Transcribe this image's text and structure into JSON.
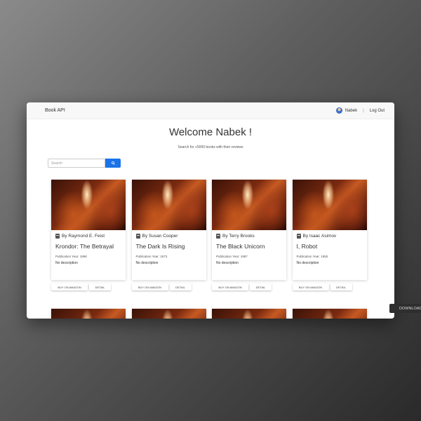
{
  "navbar": {
    "brand": "Book API",
    "username": "Nabek",
    "separator": "|",
    "logout_label": "Log Out"
  },
  "hero": {
    "title": "Welcome Nabek !",
    "subtitle": "Search for +5000 books with their reviews"
  },
  "search": {
    "placeholder": "Search"
  },
  "books": [
    {
      "author": "By Raymond E. Feist",
      "title": "Krondor: The Betrayal",
      "pub": "Publication Year: 1998",
      "desc": "No description",
      "buy": "BUY ON AMAZON",
      "detail": "DETAIL"
    },
    {
      "author": "By Susan Cooper",
      "title": "The Dark Is Rising",
      "pub": "Publication Year: 1973",
      "desc": "No description",
      "buy": "BUY ON AMAZON",
      "detail": "DETAIL"
    },
    {
      "author": "By Terry Brooks",
      "title": "The Black Unicorn",
      "pub": "Publication Year: 1987",
      "desc": "No description",
      "buy": "BUY ON AMAZON",
      "detail": "DETAIL"
    },
    {
      "author": "By Isaac Asimov",
      "title": "I, Robot",
      "pub": "Publication Year: 1950",
      "desc": "No description",
      "buy": "BUY ON AMAZON",
      "detail": "DETAIL"
    }
  ],
  "download_label": "DOWNLOAD",
  "colors": {
    "accent": "#1a73e8"
  }
}
